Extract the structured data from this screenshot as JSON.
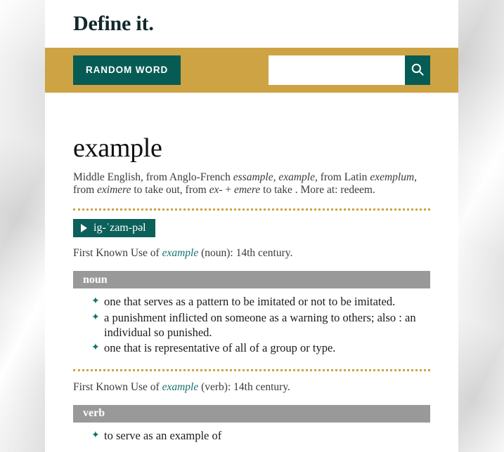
{
  "site": {
    "title": "Define it."
  },
  "toolbar": {
    "random_word_label": "RANDOM WORD",
    "search_value": "",
    "search_placeholder": "",
    "search_icon": "search-icon"
  },
  "entry": {
    "headword": "example",
    "etymology": {
      "parts": [
        {
          "text": "Middle English, from Anglo-French ",
          "italic": false
        },
        {
          "text": "essample, example",
          "italic": true
        },
        {
          "text": ", from Latin ",
          "italic": false
        },
        {
          "text": "exemplum",
          "italic": true
        },
        {
          "text": ", from ",
          "italic": false
        },
        {
          "text": "eximere",
          "italic": true
        },
        {
          "text": " to take out, from ",
          "italic": false
        },
        {
          "text": "ex-",
          "italic": true
        },
        {
          "text": " + ",
          "italic": false
        },
        {
          "text": "emere",
          "italic": true
        },
        {
          "text": " to take . More at: redeem.",
          "italic": false
        }
      ],
      "plain": "Middle English, from Anglo-French essample, example, from Latin exemplum, from eximere to take out, from ex- + emere to take . More at: redeem."
    },
    "pronunciation": {
      "text": "ig-ˈzam-pəl",
      "play_icon": "play-icon"
    },
    "sections": [
      {
        "first_known_use": {
          "prefix": "First Known Use of ",
          "word": "example",
          "suffix": " (noun): 14th century."
        },
        "part_of_speech": "noun",
        "senses": [
          "one that serves as a pattern to be imitated or not to be imitated.",
          "a punishment inflicted on someone as a warning to others; also : an individual so punished.",
          "one that is representative of all of a group or type."
        ]
      },
      {
        "first_known_use": {
          "prefix": "First Known Use of ",
          "word": "example",
          "suffix": " (verb): 14th century."
        },
        "part_of_speech": "verb",
        "senses": [
          "to serve as an example of"
        ]
      }
    ],
    "bullet_glyph": "✦"
  },
  "colors": {
    "gold": "#cda343",
    "teal": "#065c54",
    "link_teal": "#16726c",
    "pos_gray": "#999999",
    "title_dark": "#12282a"
  }
}
